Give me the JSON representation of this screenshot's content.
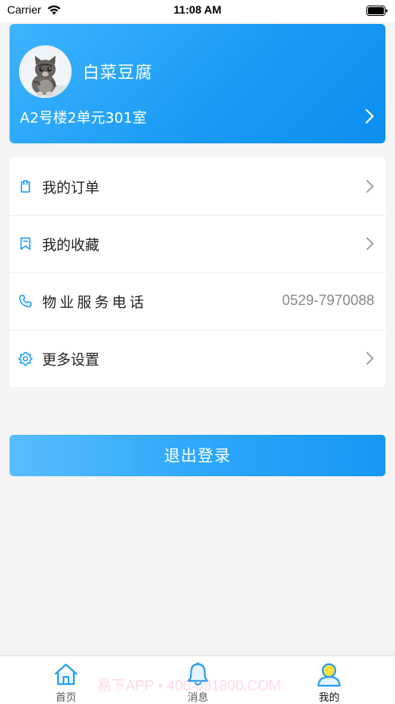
{
  "status_bar": {
    "carrier": "Carrier",
    "time": "11:08 AM"
  },
  "profile": {
    "name": "白菜豆腐",
    "address": "A2号楼2单元301室"
  },
  "menu": {
    "items": [
      {
        "label": "我的订单",
        "icon": "receipt-icon"
      },
      {
        "label": "我的收藏",
        "icon": "bookmark-icon"
      },
      {
        "label": "物业服务电话",
        "icon": "phone-icon",
        "value": "0529-7970088"
      },
      {
        "label": "更多设置",
        "icon": "gear-icon"
      }
    ]
  },
  "logout": {
    "label": "退出登录"
  },
  "tabbar": {
    "items": [
      {
        "label": "首页",
        "icon": "home-icon"
      },
      {
        "label": "消息",
        "icon": "bell-icon"
      },
      {
        "label": "我的",
        "icon": "user-icon",
        "active": true
      }
    ]
  },
  "watermark": "易下APP • 400-091800.COM",
  "colors": {
    "accent": "#1a9cf5",
    "accent_light": "#58bdff",
    "background": "#f4f4f4"
  }
}
